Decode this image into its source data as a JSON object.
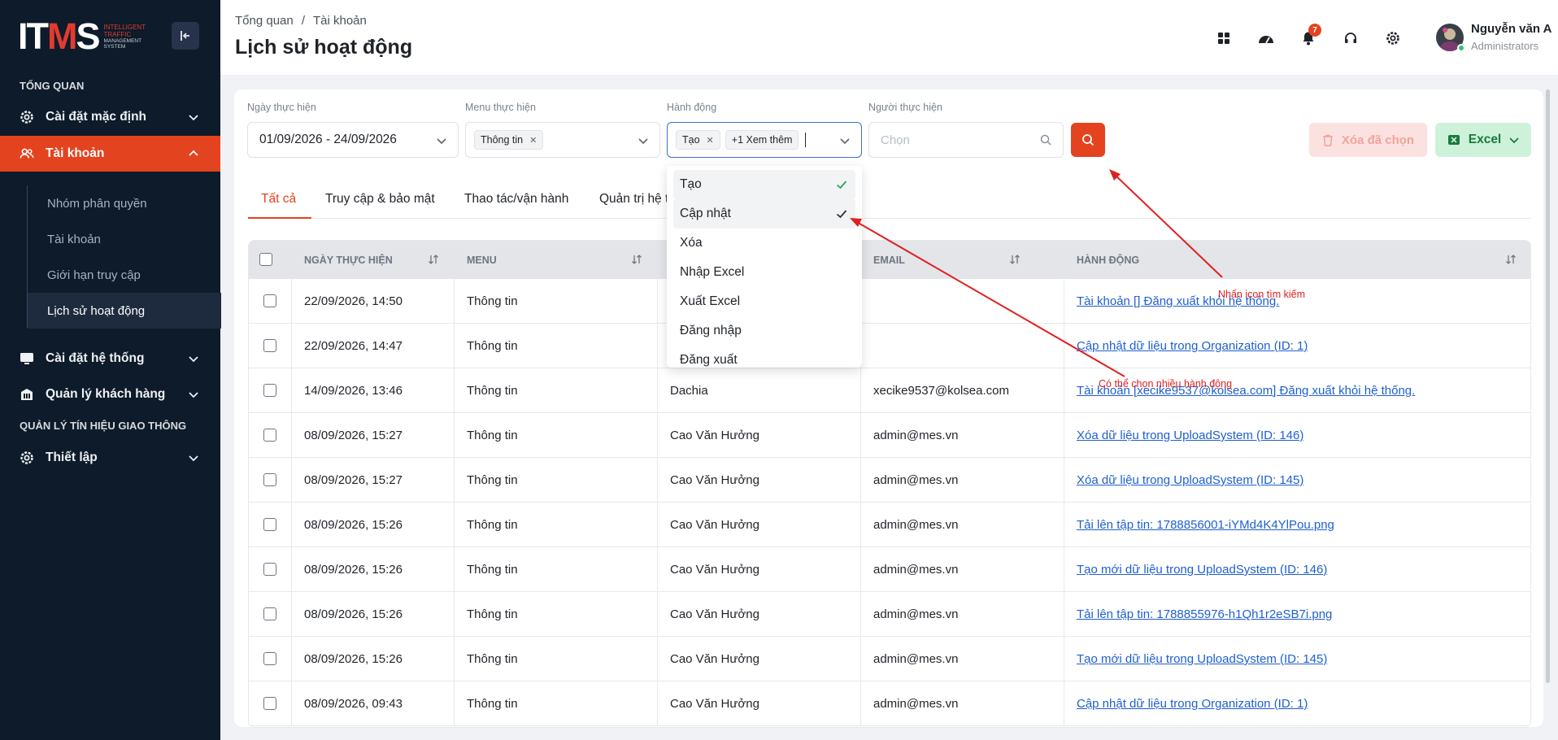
{
  "sidebar": {
    "logo": {
      "main_left": "IT",
      "main_mid": "M",
      "main_right": "S",
      "line1": "INTELLIGENT",
      "line2": "TRAFFIC",
      "line3": "MANAGEMENT",
      "line4": "SYSTEM"
    },
    "section_overview": "TỔNG QUAN",
    "section_traffic": "QUẢN LÝ TÍN HIỆU GIAO THÔNG",
    "items": {
      "default_settings": "Cài đặt mặc định",
      "accounts": "Tài khoản",
      "system_settings": "Cài đặt hệ thống",
      "customers": "Quản lý khách hàng",
      "setup": "Thiết lập"
    },
    "sub_items": [
      "Nhóm phân quyền",
      "Tài khoản",
      "Giới hạn truy cập",
      "Lịch sử hoạt động"
    ]
  },
  "header": {
    "breadcrumb_home": "Tổng quan",
    "breadcrumb_sep": "/",
    "breadcrumb_current": "Tài khoản",
    "title": "Lịch sử hoạt động",
    "notification_count": "7",
    "user_name": "Nguyễn văn A",
    "user_role": "Administrators"
  },
  "filters": {
    "date_label": "Ngày thực hiện",
    "date_value": "01/09/2026 - 24/09/2026",
    "menu_label": "Menu thực hiện",
    "menu_tag": "Thông tin",
    "action_label": "Hành động",
    "action_tag": "Tạo",
    "action_more": "+1 Xem thêm",
    "user_label": "Người thực hiện",
    "user_placeholder": "Chọn",
    "delete_label": "Xóa đã chọn",
    "excel_label": "Excel"
  },
  "tabs": [
    "Tất cả",
    "Truy cập & bảo mật",
    "Thao tác/vận hành",
    "Quản trị hệ t"
  ],
  "table": {
    "headers": {
      "date": "NGÀY THỰC HIỆN",
      "menu": "MENU",
      "email": "EMAIL",
      "action": "HÀNH ĐỘNG"
    },
    "rows": [
      {
        "date": "22/09/2026, 14:50",
        "menu": "Thông tin",
        "user": "",
        "email": "",
        "action": "Tài khoản [] Đăng xuất khỏi hệ thống."
      },
      {
        "date": "22/09/2026, 14:47",
        "menu": "Thông tin",
        "user": "",
        "email": "",
        "action": "Cập nhật dữ liệu trong Organization (ID: 1)"
      },
      {
        "date": "14/09/2026, 13:46",
        "menu": "Thông tin",
        "user": "Dachia",
        "email": "xecike9537@kolsea.com",
        "action": "Tài khoản [xecike9537@kolsea.com] Đăng xuất khỏi hệ thống."
      },
      {
        "date": "08/09/2026, 15:27",
        "menu": "Thông tin",
        "user": "Cao Văn Hưởng",
        "email": "admin@mes.vn",
        "action": "Xóa dữ liệu trong UploadSystem (ID: 146)"
      },
      {
        "date": "08/09/2026, 15:27",
        "menu": "Thông tin",
        "user": "Cao Văn Hưởng",
        "email": "admin@mes.vn",
        "action": "Xóa dữ liệu trong UploadSystem (ID: 145)"
      },
      {
        "date": "08/09/2026, 15:26",
        "menu": "Thông tin",
        "user": "Cao Văn Hưởng",
        "email": "admin@mes.vn",
        "action": "Tải lên tập tin: 1788856001-iYMd4K4YlPou.png"
      },
      {
        "date": "08/09/2026, 15:26",
        "menu": "Thông tin",
        "user": "Cao Văn Hưởng",
        "email": "admin@mes.vn",
        "action": "Tạo mới dữ liệu trong UploadSystem (ID: 146)"
      },
      {
        "date": "08/09/2026, 15:26",
        "menu": "Thông tin",
        "user": "Cao Văn Hưởng",
        "email": "admin@mes.vn",
        "action": "Tải lên tập tin: 1788855976-h1Qh1r2eSB7i.png"
      },
      {
        "date": "08/09/2026, 15:26",
        "menu": "Thông tin",
        "user": "Cao Văn Hưởng",
        "email": "admin@mes.vn",
        "action": "Tạo mới dữ liệu trong UploadSystem (ID: 145)"
      },
      {
        "date": "08/09/2026, 09:43",
        "menu": "Thông tin",
        "user": "Cao Văn Hưởng",
        "email": "admin@mes.vn",
        "action": "Cập nhật dữ liệu trong Organization (ID: 1)"
      }
    ]
  },
  "dropdown": {
    "options": [
      {
        "label": "Tạo",
        "checked": true
      },
      {
        "label": "Cập nhật",
        "checked": true
      },
      {
        "label": "Xóa",
        "checked": false
      },
      {
        "label": "Nhập Excel",
        "checked": false
      },
      {
        "label": "Xuất Excel",
        "checked": false
      },
      {
        "label": "Đăng nhập",
        "checked": false
      },
      {
        "label": "Đăng xuất",
        "checked": false
      }
    ]
  },
  "annotations": {
    "search_hint": "Nhấn icon tìm kiếm",
    "multi_hint": "Có thể chọn nhiều hành động"
  },
  "colors": {
    "accent": "#e4431f",
    "sidebar_bg": "#0d1b2a",
    "link": "#1f5fd0",
    "annotation": "#e02020"
  }
}
